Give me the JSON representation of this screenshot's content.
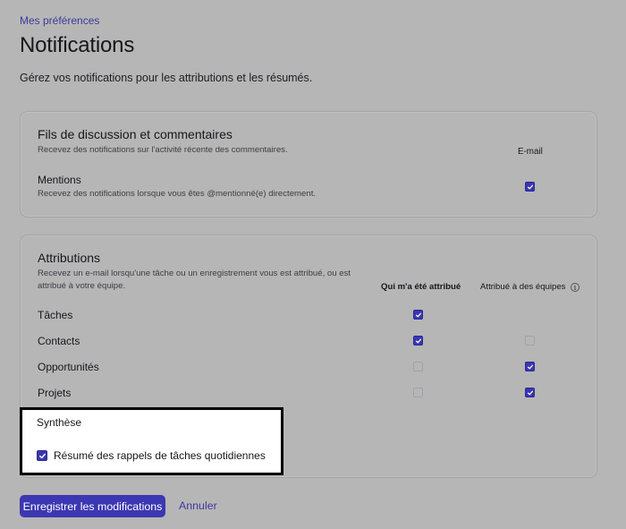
{
  "breadcrumb": "Mes préférences",
  "page": {
    "title": "Notifications",
    "description": "Gérez vos notifications pour les attributions et les résumés."
  },
  "threads": {
    "title": "Fils de discussion et commentaires",
    "description": "Recevez des notifications sur l'activité récente des commentaires.",
    "column": "E-mail",
    "mentions": {
      "title": "Mentions",
      "description": "Recevez des notifications lorsque vous êtes @mentionné(e) directement.",
      "email_checked": true
    }
  },
  "attributions": {
    "title": "Attributions",
    "description_line1": "Recevez un e-mail lorsqu'une tâche ou un enregistrement vous est attribué, ou est",
    "description_line2": "attribué à votre équipe.",
    "columns": [
      "Qui m'a été attribué",
      "Attribué à des équipes"
    ],
    "info_icon": "info-icon",
    "rows": [
      {
        "label": "Tâches",
        "me": true,
        "teams": null
      },
      {
        "label": "Contacts",
        "me": true,
        "teams": false
      },
      {
        "label": "Opportunités",
        "me": false,
        "teams": true
      },
      {
        "label": "Projets",
        "me": false,
        "teams": true
      }
    ]
  },
  "digest": {
    "title": "Synthèse",
    "option_label": "Résumé des rappels de tâches quotidiennes",
    "checked": true
  },
  "actions": {
    "save_label": "Enregistrer les modifications",
    "cancel_label": "Annuler"
  },
  "colors": {
    "accent": "#3b36b0",
    "link": "#3c3a9e",
    "background": "#b6b6b6"
  }
}
